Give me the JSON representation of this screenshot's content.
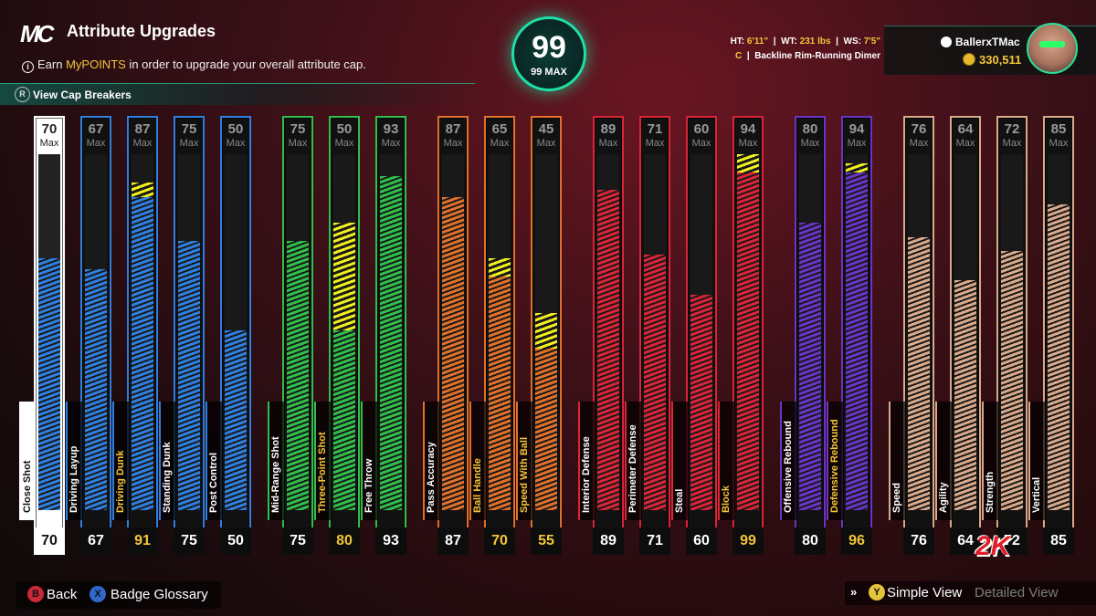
{
  "header": {
    "logo": "MC",
    "title": "Attribute Upgrades",
    "subtitle_prefix": "Earn ",
    "subtitle_highlight": "MyPOINTS",
    "subtitle_suffix": " in order to upgrade your overall attribute cap.",
    "cap_breakers_label": "View Cap Breakers",
    "cap_breakers_button": "R"
  },
  "overall": {
    "value": "99",
    "max_label": "99 MAX"
  },
  "player": {
    "ht_label": "HT:",
    "ht": "6'11\"",
    "wt_label": "WT:",
    "wt": "231 lbs",
    "ws_label": "WS:",
    "ws": "7'5\"",
    "position": "C",
    "archetype": "Backline Rim-Running Dimer",
    "gamertag": "BallerxTMac",
    "vc": "330,511"
  },
  "max_label": "Max",
  "attributes": [
    {
      "name": "Close Shot",
      "cap": "70",
      "value": "70",
      "boost": 0,
      "color": "#2f7fe0",
      "selected": true
    },
    {
      "name": "Driving Layup",
      "cap": "67",
      "value": "67",
      "boost": 0,
      "color": "#2f7fe0"
    },
    {
      "name": "Driving Dunk",
      "cap": "87",
      "value": "91",
      "boost": 4,
      "color": "#2f7fe0",
      "highlight": true
    },
    {
      "name": "Standing Dunk",
      "cap": "75",
      "value": "75",
      "boost": 0,
      "color": "#2f7fe0"
    },
    {
      "name": "Post Control",
      "cap": "50",
      "value": "50",
      "boost": 0,
      "color": "#2f7fe0"
    },
    {
      "name": "Mid-Range Shot",
      "cap": "75",
      "value": "75",
      "boost": 0,
      "color": "#2fbf4a"
    },
    {
      "name": "Three-Point Shot",
      "cap": "50",
      "value": "80",
      "boost": 30,
      "color": "#2fbf4a",
      "highlight": true
    },
    {
      "name": "Free Throw",
      "cap": "93",
      "value": "93",
      "boost": 0,
      "color": "#2fbf4a"
    },
    {
      "name": "Pass Accuracy",
      "cap": "87",
      "value": "87",
      "boost": 0,
      "color": "#e0702a"
    },
    {
      "name": "Ball Handle",
      "cap": "65",
      "value": "70",
      "boost": 5,
      "color": "#e0702a",
      "highlight": true
    },
    {
      "name": "Speed With Ball",
      "cap": "45",
      "value": "55",
      "boost": 10,
      "color": "#e0702a",
      "highlight": true
    },
    {
      "name": "Interior Defense",
      "cap": "89",
      "value": "89",
      "boost": 0,
      "color": "#dc2438"
    },
    {
      "name": "Perimeter Defense",
      "cap": "71",
      "value": "71",
      "boost": 0,
      "color": "#dc2438"
    },
    {
      "name": "Steal",
      "cap": "60",
      "value": "60",
      "boost": 0,
      "color": "#dc2438"
    },
    {
      "name": "Block",
      "cap": "94",
      "value": "99",
      "boost": 5,
      "color": "#dc2438",
      "highlight": true
    },
    {
      "name": "Offensive Rebound",
      "cap": "80",
      "value": "80",
      "boost": 0,
      "color": "#6a34c8"
    },
    {
      "name": "Defensive Rebound",
      "cap": "94",
      "value": "96",
      "boost": 2,
      "color": "#6a34c8",
      "highlight": true
    },
    {
      "name": "Speed",
      "cap": "76",
      "value": "76",
      "boost": 0,
      "color": "#d9a98a"
    },
    {
      "name": "Agility",
      "cap": "64",
      "value": "64",
      "boost": 0,
      "color": "#d9a98a"
    },
    {
      "name": "Strength",
      "cap": "72",
      "value": "72",
      "boost": 0,
      "color": "#d9a98a"
    },
    {
      "name": "Vertical",
      "cap": "85",
      "value": "85",
      "boost": 0,
      "color": "#d9a98a"
    }
  ],
  "footer": {
    "back_button": "B",
    "back_label": "Back",
    "glossary_button": "X",
    "glossary_label": "Badge Glossary",
    "view_button": "Y",
    "simple_label": "Simple View",
    "detailed_label": "Detailed View"
  },
  "brand": "2K"
}
